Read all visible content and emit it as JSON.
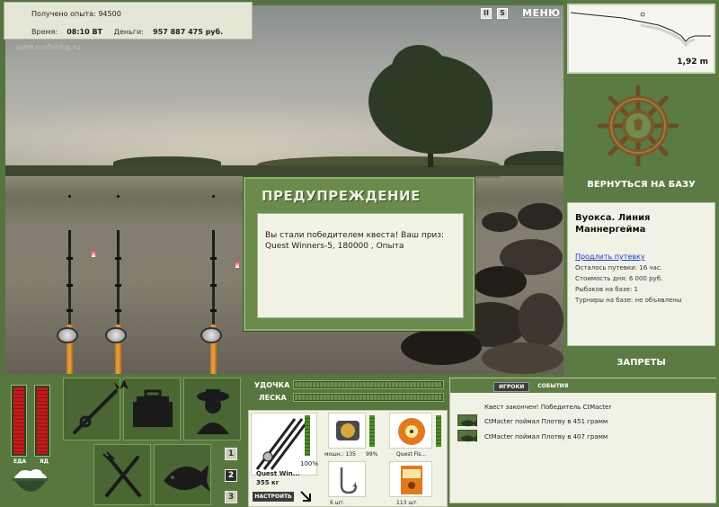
{
  "hud": {
    "experience_label": "Получено опыта:",
    "experience_value": "94500",
    "time_label": "Время:",
    "time_value": "08:10 ВТ",
    "money_label": "Деньги:",
    "money_value": "957 887 475 руб."
  },
  "watermark": "www.rusfishing.ru",
  "top_controls": {
    "pause": "II",
    "sound": "S",
    "menu": "МЕНЮ"
  },
  "depth": {
    "value": "1,92 m"
  },
  "right_panel": {
    "back_to_base": "ВЕРНУТЬСЯ НА БАЗУ",
    "location_title": "Вуокса. Линия Маннергейма",
    "extend_trip": "Продлить путевку",
    "trip_left": "Осталось путевки: 16 час.",
    "day_cost": "Стоимость дня: 6 000 руб.",
    "fishers": "Рыбаков на базе: 1",
    "tournaments": "Турниры на базе: не объявлены",
    "bans": "ЗАПРЕТЫ"
  },
  "dialog": {
    "title": "ПРЕДУПРЕЖДЕНИЕ",
    "message": "Вы стали победителем квеста! Ваш приз: Quest Winners-5, 180000 , Опыта"
  },
  "status_bars": {
    "food_label": "ЕДА",
    "food_level": 0.97,
    "poison_label": "ЯД",
    "poison_level": 0.97
  },
  "page_tabs": [
    "1",
    "2",
    "3"
  ],
  "active_page": "2",
  "tackle": {
    "rod_label": "УДОЧКА",
    "line_label": "ЛЕСКА",
    "rod_name": "Quest Win...",
    "rod_weight": "355 кг",
    "rod_condition": "100%",
    "reel_power": "мошн.: 135",
    "reel_condition": "99%",
    "line_name": "Quest Fis...",
    "hook_count": "6 шт.",
    "bait_count": "113 шт.",
    "setup_button": "НАСТРОИТЬ"
  },
  "chat": {
    "tab_players": "ИГРОКИ",
    "tab_events": "СОБЫТИЯ",
    "messages": [
      "Квест закончен! Победитель CtMacter",
      "CtMacter поймал Плотву в 451 грамм",
      "CtMacter поймал Плотву в 407 грамм"
    ]
  }
}
